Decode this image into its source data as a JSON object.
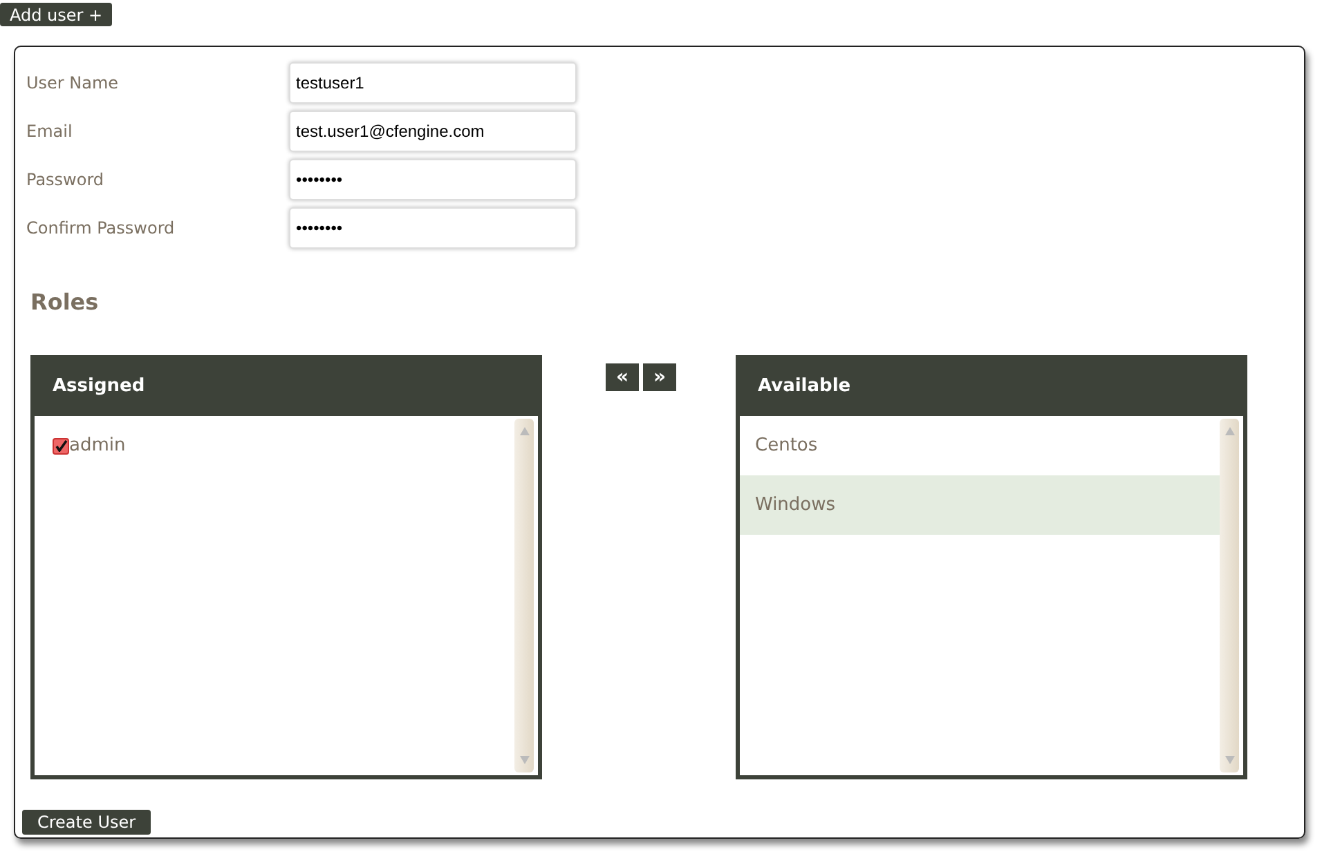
{
  "add_button": "Add user +",
  "fields": [
    {
      "label": "User Name",
      "value": "testuser1"
    },
    {
      "label": "Email",
      "value": "test.user1@cfengine.com"
    },
    {
      "label": "Password",
      "value": "••••••••"
    },
    {
      "label": "Confirm Password",
      "value": "••••••••"
    }
  ],
  "roles_title": "Roles",
  "assigned": {
    "title": "Assigned",
    "items": [
      {
        "label": "admin",
        "checked": true
      }
    ]
  },
  "move_buttons": [
    "«",
    "»"
  ],
  "available": {
    "title": "Available",
    "items": [
      {
        "label": "Centos",
        "selected": false
      },
      {
        "label": "Windows",
        "selected": true
      }
    ]
  },
  "submit_button": "Create User"
}
